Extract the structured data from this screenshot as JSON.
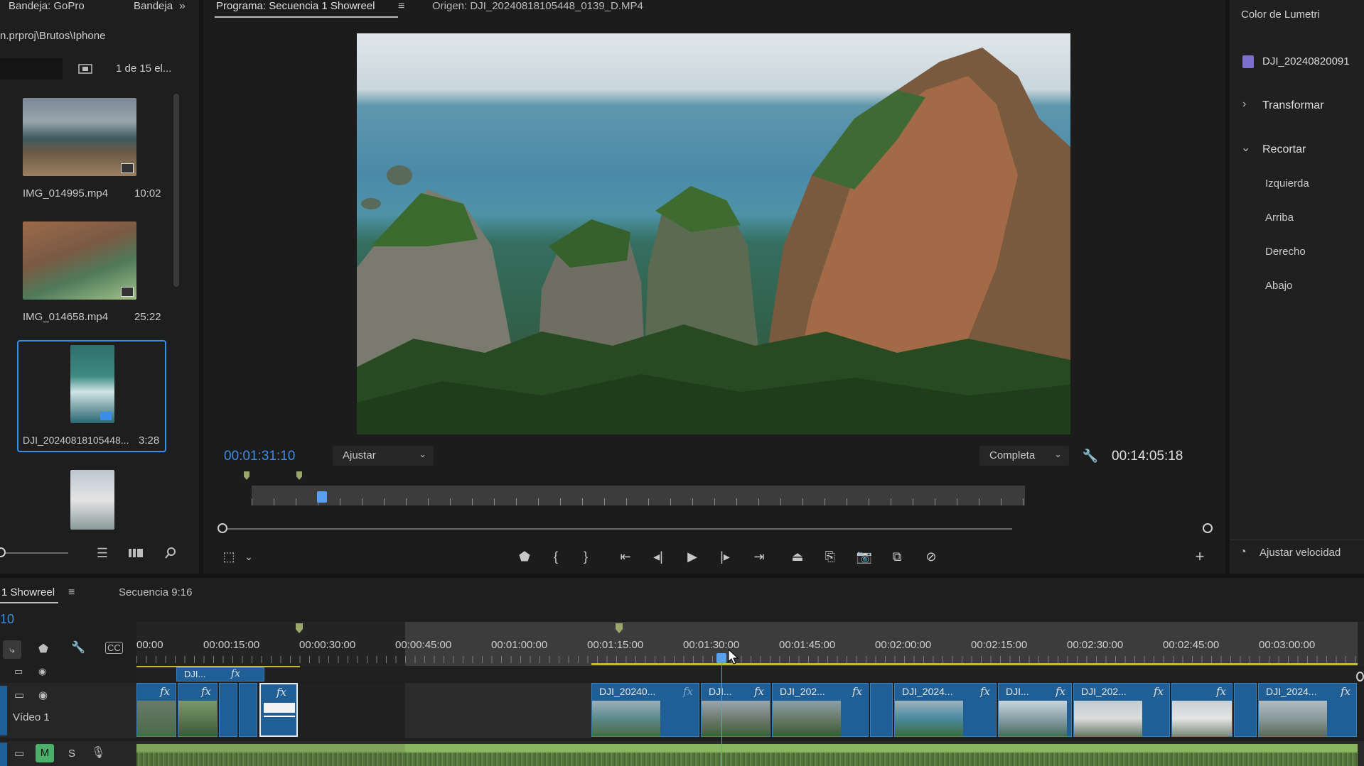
{
  "project_panel": {
    "tab1": "Bandeja: GoPro",
    "tab2": "Bandeja",
    "path": "n.prproj\\Brutos\\Iphone",
    "count": "1 de 15 el...",
    "items": [
      {
        "name": "IMG_014995.mp4",
        "duration": "10:02"
      },
      {
        "name": "IMG_014658.mp4",
        "duration": "25:22"
      },
      {
        "name": "DJI_20240818105448...",
        "duration": "3:28"
      }
    ]
  },
  "program_monitor": {
    "tab_program": "Programa: Secuencia 1 Showreel",
    "tab_source": "Origen: DJI_20240818105448_0139_D.MP4",
    "current_time": "00:01:31:10",
    "fit_select": "Ajustar",
    "quality_select": "Completa",
    "duration": "00:14:05:18"
  },
  "lumetri": {
    "title": "Color de Lumetri",
    "clip": "DJI_20240820091",
    "sections": [
      "Transformar",
      "Recortar"
    ],
    "crop_params": [
      "Izquierda",
      "Arriba",
      "Derecho",
      "Abajo"
    ],
    "speed_button": "Ajustar velocidad"
  },
  "timeline": {
    "tab_active": "1 Showreel",
    "tab_other": "Secuencia 9:16",
    "timecode": "10",
    "ruler": [
      "00:00",
      "00:00:15:00",
      "00:00:30:00",
      "00:00:45:00",
      "00:01:00:00",
      "00:01:15:00",
      "00:01:30:00",
      "00:01:45:00",
      "00:02:00:00",
      "00:02:15:00",
      "00:02:30:00",
      "00:02:45:00",
      "00:03:00:00"
    ],
    "track_v1": "Vídeo 1",
    "track_m": "M",
    "track_s": "S",
    "upper_clip": "DJI...",
    "clips": [
      "DJI_20240...",
      "DJI...",
      "DJI_202...",
      "DJI_2024...",
      "DJI...",
      "DJI_202...",
      "DJI_2024..."
    ],
    "fx": "fx"
  },
  "colors": {
    "accent": "#3a8ee6",
    "clip": "#1f5f95",
    "audio": "#7fa35a",
    "playhead": "#5aa0f0"
  }
}
